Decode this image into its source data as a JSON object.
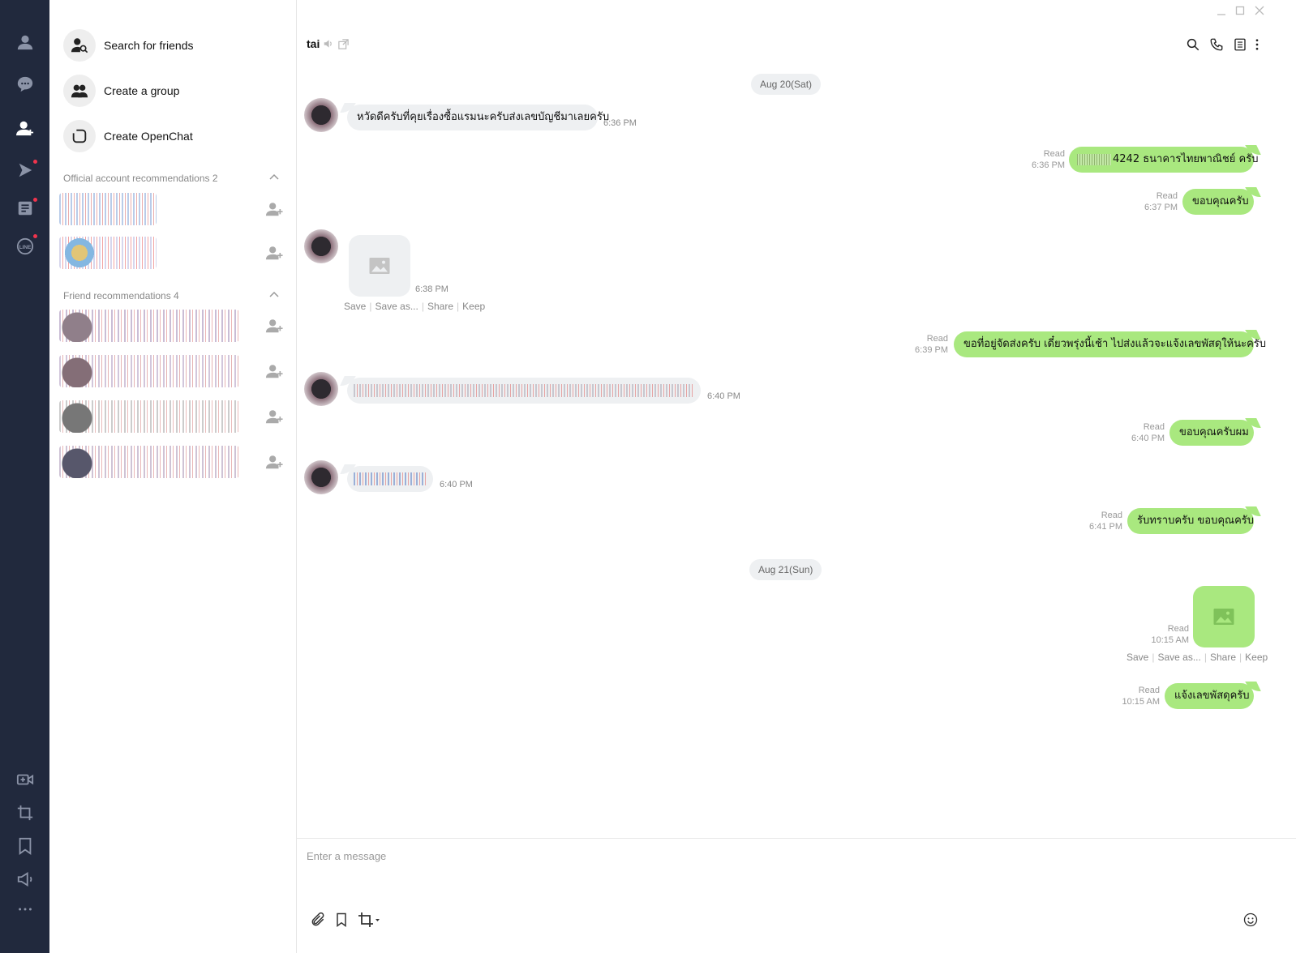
{
  "colors": {
    "rail_bg": "#21293d",
    "rail_icon": "#8b93a7",
    "rail_active": "#ffffff",
    "badge_red": "#f0344d",
    "incoming_bubble": "#eef0f2",
    "outgoing_bubble": "#a9e87f"
  },
  "rail": {
    "top_icons": [
      "person-icon",
      "chat-bubble-icon",
      "add-friend-icon",
      "play-icon",
      "news-icon",
      "line-icon"
    ],
    "bottom_icons": [
      "video-call-icon",
      "crop-icon",
      "bookmark-icon",
      "megaphone-icon",
      "more-icon"
    ]
  },
  "panel": {
    "actions": {
      "search_friends": "Search for friends",
      "create_group": "Create a group",
      "create_openchat": "Create OpenChat"
    },
    "official_title": "Official account recommendations 2",
    "friend_title": "Friend recommendations 4"
  },
  "chat": {
    "title": "tai",
    "date_1": "Aug 20(Sat)",
    "date_2": "Aug 21(Sun)",
    "messages": {
      "m1_text": "หวัดดีครับที่คุยเรื่องซื้อแรมนะครับส่งเลขบัญชีมาเลยครับ",
      "m1_time": "6:36 PM",
      "m2_text": "4242 ธนาคารไทยพาณิชย์ ครับ",
      "m2_read": "Read",
      "m2_time": "6:36 PM",
      "m3_text": "ขอบคุณครับ",
      "m3_read": "Read",
      "m3_time": "6:37 PM",
      "m4_time": "6:38 PM",
      "m5_text": "ขอที่อยู่จัดส่งครับ เดี๋ยวพรุ่งนี้เช้า ไปส่งแล้วจะแจ้งเลขพัสดุให้นะครับ",
      "m5_read": "Read",
      "m5_time": "6:39 PM",
      "m6_time": "6:40 PM",
      "m7_text": "ขอบคุณครับผม",
      "m7_read": "Read",
      "m7_time": "6:40 PM",
      "m8_time": "6:40 PM",
      "m9_text": "รับทราบครับ ขอบคุณครับ",
      "m9_read": "Read",
      "m9_time": "6:41 PM",
      "m10_read": "Read",
      "m10_time": "10:15 AM",
      "m11_text": "แจ้งเลขพัสดุครับ",
      "m11_read": "Read",
      "m11_time": "10:15 AM"
    },
    "image_actions": {
      "save": "Save",
      "save_as": "Save as...",
      "share": "Share",
      "keep": "Keep"
    },
    "composer_placeholder": "Enter a message"
  }
}
